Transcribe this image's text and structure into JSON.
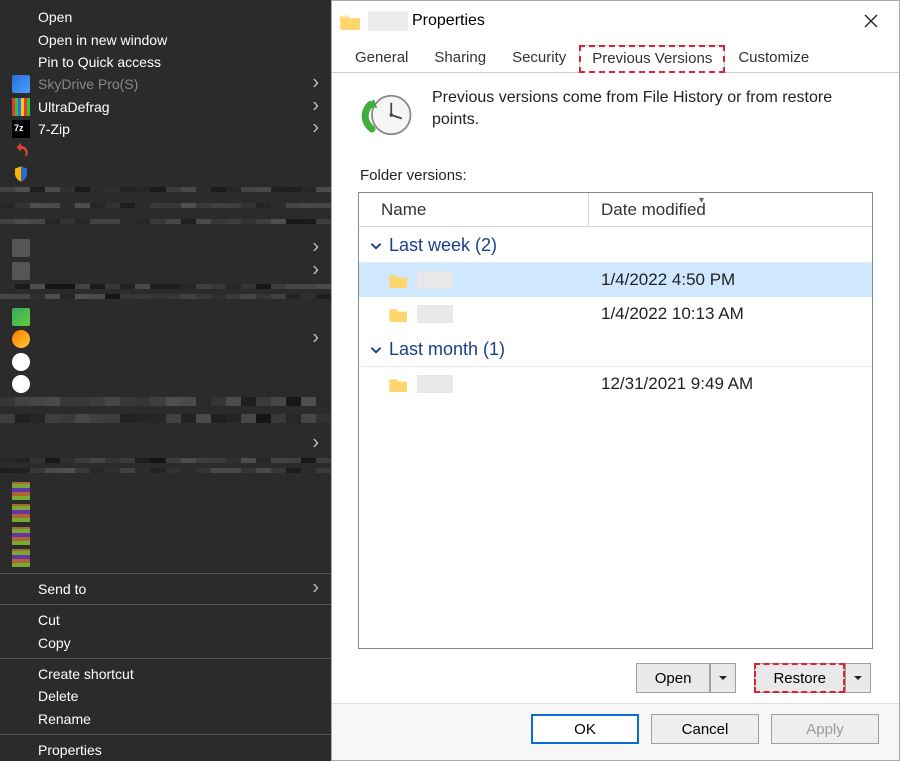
{
  "context_menu": {
    "open": "Open",
    "open_new_window": "Open in new window",
    "pin_quick_access": "Pin to Quick access",
    "skydrive": "SkyDrive Pro(S)",
    "ultradefrag": "UltraDefrag",
    "sevenzip": "7-Zip",
    "send_to": "Send to",
    "cut": "Cut",
    "copy": "Copy",
    "create_shortcut": "Create shortcut",
    "delete": "Delete",
    "rename": "Rename",
    "properties": "Properties"
  },
  "dialog": {
    "title_suffix": "Properties",
    "tabs": {
      "general": "General",
      "sharing": "Sharing",
      "security": "Security",
      "previous_versions": "Previous Versions",
      "customize": "Customize"
    },
    "active_tab": "previous_versions",
    "info_text": "Previous versions come from File History or from restore points.",
    "list_label": "Folder versions:",
    "columns": {
      "name": "Name",
      "date": "Date modified"
    },
    "groups": [
      {
        "label": "Last week (2)",
        "items": [
          {
            "date": "1/4/2022 4:50 PM",
            "selected": true
          },
          {
            "date": "1/4/2022 10:13 AM",
            "selected": false
          }
        ]
      },
      {
        "label": "Last month (1)",
        "items": [
          {
            "date": "12/31/2021 9:49 AM",
            "selected": false
          }
        ]
      }
    ],
    "buttons": {
      "open": "Open",
      "restore": "Restore",
      "ok": "OK",
      "cancel": "Cancel",
      "apply": "Apply"
    }
  }
}
